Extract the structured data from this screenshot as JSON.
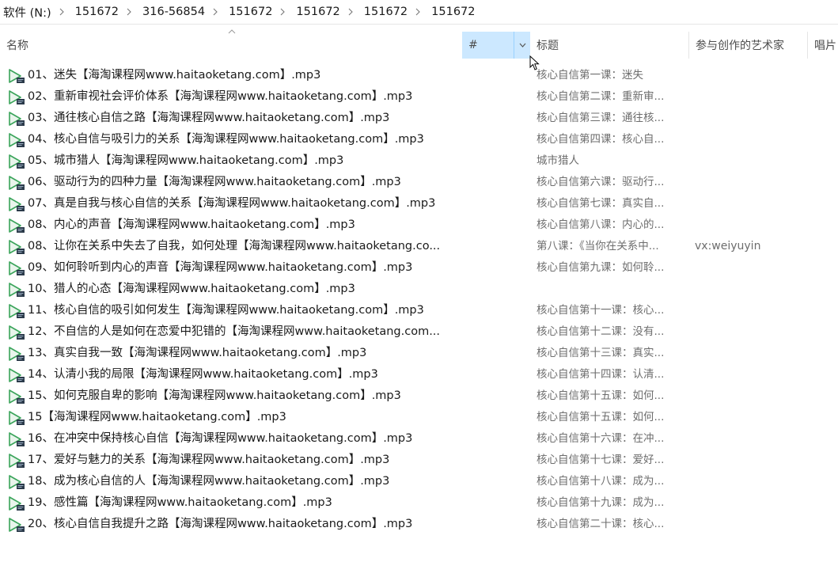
{
  "breadcrumb": [
    "软件 (N:)",
    "151672",
    "316-56854",
    "151672",
    "151672",
    "151672",
    "151672"
  ],
  "columns": {
    "name": "名称",
    "number": "#",
    "title": "标题",
    "artist": "参与创作的艺术家",
    "album": "唱片"
  },
  "files": [
    {
      "name": "01、迷失【海淘课程网www.haitaoketang.com】.mp3",
      "title": "核心自信第一课：迷失",
      "artist": ""
    },
    {
      "name": "02、重新审视社会评价体系【海淘课程网www.haitaoketang.com】.mp3",
      "title": "核心自信第二课：重新审...",
      "artist": ""
    },
    {
      "name": "03、通往核心自信之路【海淘课程网www.haitaoketang.com】.mp3",
      "title": "核心自信第三课：通往核...",
      "artist": ""
    },
    {
      "name": "04、核心自信与吸引力的关系【海淘课程网www.haitaoketang.com】.mp3",
      "title": "核心自信第四课：核心自...",
      "artist": ""
    },
    {
      "name": "05、城市猎人【海淘课程网www.haitaoketang.com】.mp3",
      "title": "城市猎人",
      "artist": ""
    },
    {
      "name": "06、驱动行为的四种力量【海淘课程网www.haitaoketang.com】.mp3",
      "title": "核心自信第六课：驱动行...",
      "artist": ""
    },
    {
      "name": "07、真是自我与核心自信的关系【海淘课程网www.haitaoketang.com】.mp3",
      "title": "核心自信第七课：真实自...",
      "artist": ""
    },
    {
      "name": "08、内心的声音【海淘课程网www.haitaoketang.com】.mp3",
      "title": "核心自信第八课：内心的...",
      "artist": ""
    },
    {
      "name": "08、让你在关系中失去了自我，如何处理【海淘课程网www.haitaoketang.co...",
      "title": "第八课：《当你在关系中...",
      "artist": "vx:weiyuyin"
    },
    {
      "name": "09、如何聆听到内心的声音【海淘课程网www.haitaoketang.com】.mp3",
      "title": "核心自信第九课：如何聆...",
      "artist": ""
    },
    {
      "name": "10、猎人的心态【海淘课程网www.haitaoketang.com】.mp3",
      "title": "",
      "artist": ""
    },
    {
      "name": "11、核心自信的吸引如何发生【海淘课程网www.haitaoketang.com】.mp3",
      "title": "核心自信第十一课：核心...",
      "artist": ""
    },
    {
      "name": "12、不自信的人是如何在恋爱中犯错的【海淘课程网www.haitaoketang.com...",
      "title": "核心自信第十二课：没有...",
      "artist": ""
    },
    {
      "name": "13、真实自我一致【海淘课程网www.haitaoketang.com】.mp3",
      "title": "核心自信第十三课：真实...",
      "artist": ""
    },
    {
      "name": "14、认清小我的局限【海淘课程网www.haitaoketang.com】.mp3",
      "title": "核心自信第十四课：认清...",
      "artist": ""
    },
    {
      "name": "15、如何克服自卑的影响【海淘课程网www.haitaoketang.com】.mp3",
      "title": "核心自信第十五课：如何...",
      "artist": ""
    },
    {
      "name": "15【海淘课程网www.haitaoketang.com】.mp3",
      "title": "核心自信第十五课：如何...",
      "artist": ""
    },
    {
      "name": "16、在冲突中保持核心自信【海淘课程网www.haitaoketang.com】.mp3",
      "title": "核心自信第十六课：在冲...",
      "artist": ""
    },
    {
      "name": "17、爱好与魅力的关系【海淘课程网www.haitaoketang.com】.mp3",
      "title": "核心自信第十七课：爱好...",
      "artist": ""
    },
    {
      "name": "18、成为核心自信的人【海淘课程网www.haitaoketang.com】.mp3",
      "title": "核心自信第十八课：成为...",
      "artist": ""
    },
    {
      "name": "19、感性篇【海淘课程网www.haitaoketang.com】.mp3",
      "title": "核心自信第十九课：成为...",
      "artist": ""
    },
    {
      "name": "20、核心自信自我提升之路【海淘课程网www.haitaoketang.com】.mp3",
      "title": "核心自信第二十课：核心...",
      "artist": ""
    }
  ],
  "icons": {
    "file": "mp3-file-icon",
    "separator": "chevron-right-icon",
    "sort": "sort-ascending-icon",
    "dropdown": "chevron-down-icon",
    "cursor": "mouse-pointer-icon"
  },
  "colors": {
    "selected_header": "#cce8ff",
    "icon_green": "#3aa45a",
    "icon_dark": "#2b3a4a",
    "muted_text": "#6d6d6d"
  }
}
